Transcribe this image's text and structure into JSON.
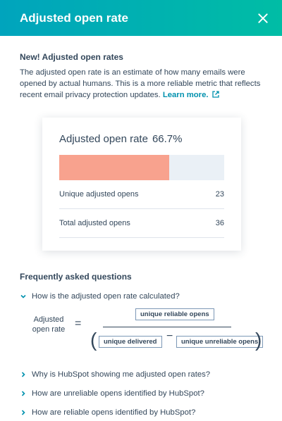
{
  "header": {
    "title": "Adjusted open rate"
  },
  "intro": {
    "heading": "New! Adjusted open rates",
    "text": "The adjusted open rate is an estimate of how many emails were opened by actual humans. This is a more reliable metric that reflects recent email privacy protection updates.",
    "link_label": "Learn more."
  },
  "card": {
    "metric_label": "Adjusted open rate",
    "metric_value": "66.7%",
    "bar_fraction": 0.667,
    "rows": [
      {
        "label": "Unique adjusted opens",
        "value": "23"
      },
      {
        "label": "Total adjusted opens",
        "value": "36"
      }
    ]
  },
  "faq": {
    "heading": "Frequently asked questions",
    "items": [
      "How is the adjusted open rate calculated?",
      "Why is HubSpot showing me adjusted open rates?",
      "How are unreliable opens identified by HubSpot?",
      "How are reliable opens identified by HubSpot?"
    ],
    "formula": {
      "label": "Adjusted open rate",
      "equals": "=",
      "numerator": "unique reliable opens",
      "denominator_left": "unique delivered",
      "minus": "−",
      "denominator_right": "unique unreliable opens"
    }
  },
  "colors": {
    "accent": "#0091ae",
    "bar_fill": "#f8a28e",
    "bar_track": "#eaf0f6"
  }
}
